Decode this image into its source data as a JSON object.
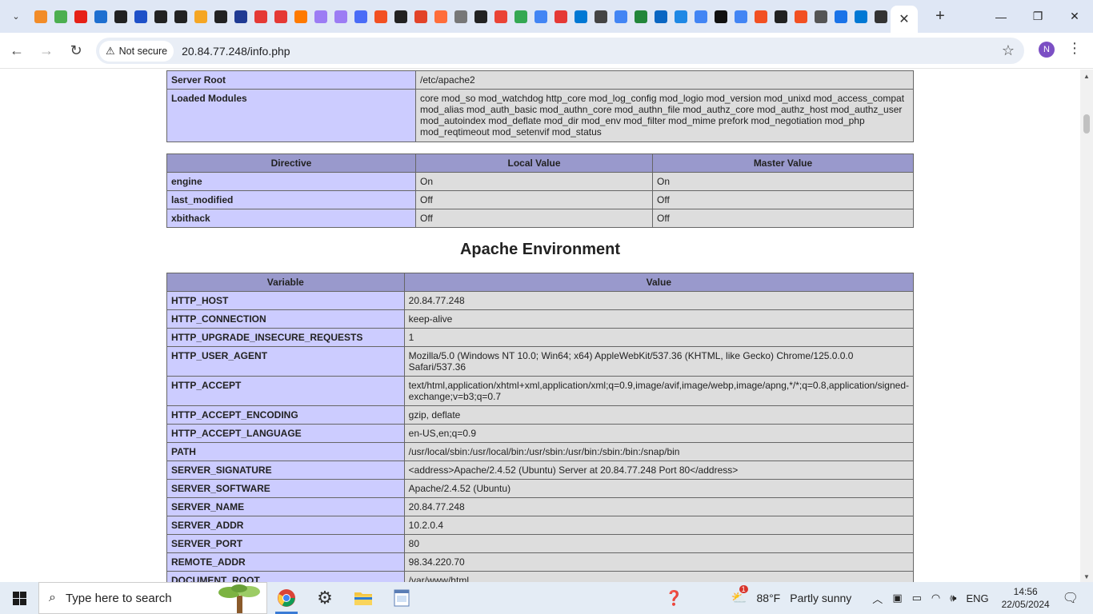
{
  "browser": {
    "url": "20.84.77.248/info.php",
    "security_label": "Not secure",
    "profile_initial": "N",
    "pinned_tab_colors": [
      "#f28c28",
      "#4caf50",
      "#e62117",
      "#1e6fd0",
      "#222",
      "#1e50c8",
      "#222",
      "#222",
      "#f5a623",
      "#222",
      "#1f3a93",
      "#e53935",
      "#e53935",
      "#ff7a00",
      "#9c7cf4",
      "#9c7cf4",
      "#4a6cf7",
      "#f25022",
      "#222",
      "#e24329",
      "#ff6d3a",
      "#777",
      "#222",
      "#ea4335",
      "#34a853",
      "#4285f4",
      "#e53935",
      "#0078d4",
      "#444",
      "#4285f4",
      "#22863a",
      "#0a66c2",
      "#1e88e5",
      "#4285f4",
      "#111",
      "#4285f4",
      "#f25022",
      "#222",
      "#f25022",
      "#555",
      "#1a73e8",
      "#0078d4",
      "#333"
    ]
  },
  "page": {
    "top_table": [
      {
        "label": "Server Root",
        "value": "/etc/apache2"
      },
      {
        "label": "Loaded Modules",
        "value": "core mod_so mod_watchdog http_core mod_log_config mod_logio mod_version mod_unixd mod_access_compat mod_alias mod_auth_basic mod_authn_core mod_authn_file mod_authz_core mod_authz_host mod_authz_user mod_autoindex mod_deflate mod_dir mod_env mod_filter mod_mime prefork mod_negotiation mod_php mod_reqtimeout mod_setenvif mod_status"
      }
    ],
    "directive_table": {
      "headers": [
        "Directive",
        "Local Value",
        "Master Value"
      ],
      "rows": [
        {
          "directive": "engine",
          "local": "On",
          "master": "On"
        },
        {
          "directive": "last_modified",
          "local": "Off",
          "master": "Off"
        },
        {
          "directive": "xbithack",
          "local": "Off",
          "master": "Off"
        }
      ]
    },
    "env_title": "Apache Environment",
    "env_table": {
      "headers": [
        "Variable",
        "Value"
      ],
      "rows": [
        {
          "name": "HTTP_HOST",
          "value": "20.84.77.248"
        },
        {
          "name": "HTTP_CONNECTION",
          "value": "keep-alive"
        },
        {
          "name": "HTTP_UPGRADE_INSECURE_REQUESTS",
          "value": "1"
        },
        {
          "name": "HTTP_USER_AGENT",
          "value": "Mozilla/5.0 (Windows NT 10.0; Win64; x64) AppleWebKit/537.36 (KHTML, like Gecko) Chrome/125.0.0.0 Safari/537.36"
        },
        {
          "name": "HTTP_ACCEPT",
          "value": "text/html,application/xhtml+xml,application/xml;q=0.9,image/avif,image/webp,image/apng,*/*;q=0.8,application/signed-exchange;v=b3;q=0.7"
        },
        {
          "name": "HTTP_ACCEPT_ENCODING",
          "value": "gzip, deflate"
        },
        {
          "name": "HTTP_ACCEPT_LANGUAGE",
          "value": "en-US,en;q=0.9"
        },
        {
          "name": "PATH",
          "value": "/usr/local/sbin:/usr/local/bin:/usr/sbin:/usr/bin:/sbin:/bin:/snap/bin"
        },
        {
          "name": "SERVER_SIGNATURE",
          "value": "<address>Apache/2.4.52 (Ubuntu) Server at 20.84.77.248 Port 80</address>"
        },
        {
          "name": "SERVER_SOFTWARE",
          "value": "Apache/2.4.52 (Ubuntu)"
        },
        {
          "name": "SERVER_NAME",
          "value": "20.84.77.248"
        },
        {
          "name": "SERVER_ADDR",
          "value": "10.2.0.4"
        },
        {
          "name": "SERVER_PORT",
          "value": "80"
        },
        {
          "name": "REMOTE_ADDR",
          "value": "98.34.220.70"
        },
        {
          "name": "DOCUMENT_ROOT",
          "value": "/var/www/html"
        }
      ]
    }
  },
  "taskbar": {
    "search_placeholder": "Type here to search",
    "weather_temp": "88°F",
    "weather_desc": "Partly sunny",
    "weather_badge": "1",
    "language": "ENG",
    "time": "14:56",
    "date": "22/05/2024"
  }
}
